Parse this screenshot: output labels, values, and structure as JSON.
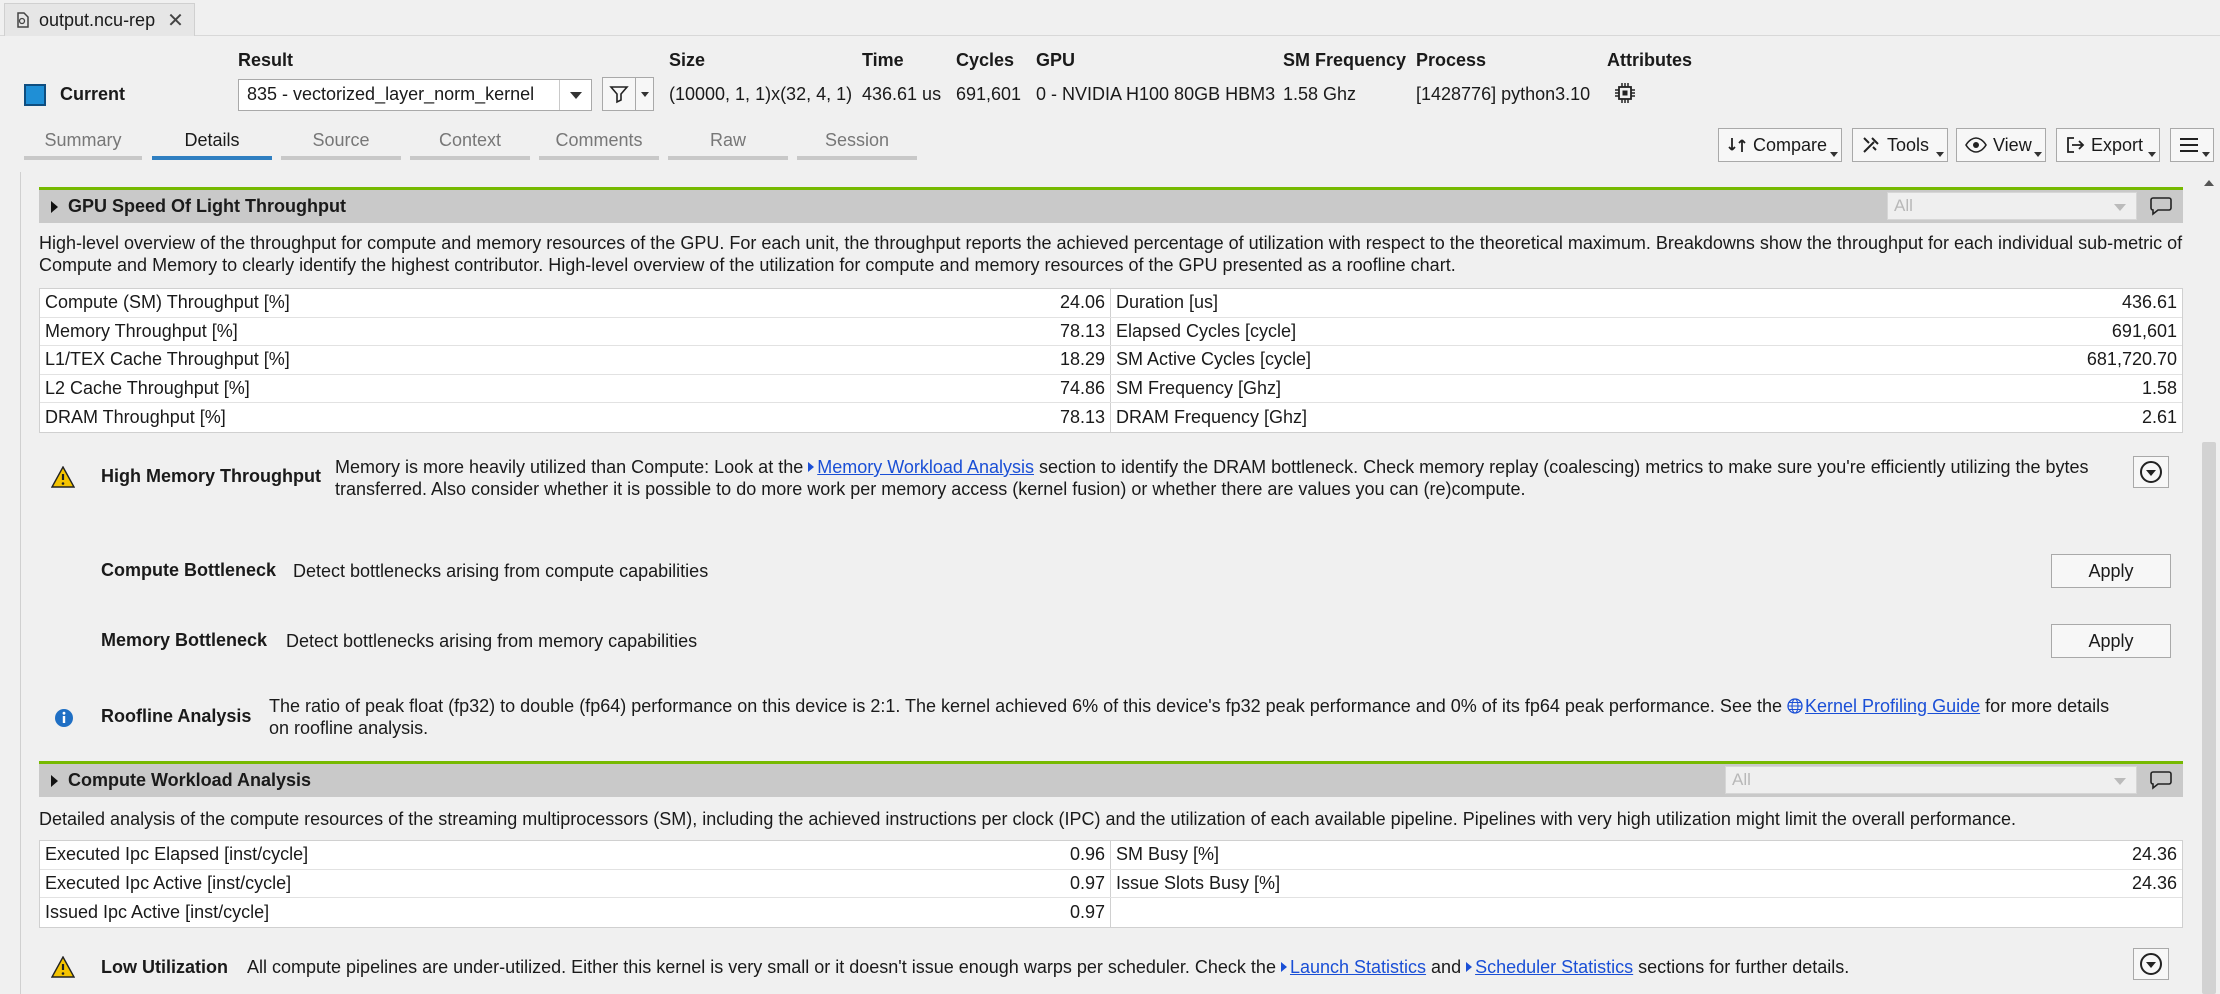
{
  "file_tab": {
    "name": "output.ncu-rep",
    "close": "✕"
  },
  "header": {
    "labels": {
      "result": "Result",
      "size": "Size",
      "time": "Time",
      "cycles": "Cycles",
      "gpu": "GPU",
      "sm_frequency": "SM Frequency",
      "process": "Process",
      "attributes": "Attributes"
    },
    "current_label": "Current",
    "current_color": "#1f8fd6",
    "result_value": "835 - vectorized_layer_norm_kernel",
    "size": "(10000, 1, 1)x(32, 4, 1)",
    "time": "436.61 us",
    "cycles": "691,601",
    "gpu": "0 - NVIDIA H100 80GB HBM3",
    "sm_frequency": "1.58 Ghz",
    "process": "[1428776] python3.10"
  },
  "page_tabs": [
    {
      "label": "Summary",
      "active": false
    },
    {
      "label": "Details",
      "active": true
    },
    {
      "label": "Source",
      "active": false
    },
    {
      "label": "Context",
      "active": false
    },
    {
      "label": "Comments",
      "active": false
    },
    {
      "label": "Raw",
      "active": false
    },
    {
      "label": "Session",
      "active": false
    }
  ],
  "toolbar": {
    "compare": "Compare",
    "tools": "Tools",
    "view": "View",
    "export": "Export"
  },
  "sections": {
    "sol": {
      "title": "GPU Speed Of Light Throughput",
      "filter": "All",
      "description": "High-level overview of the throughput for compute and memory resources of the GPU. For each unit, the throughput reports the achieved percentage of utilization with respect to the theoretical maximum. Breakdowns show the throughput for each individual sub-metric of Compute and Memory to clearly identify the highest contributor. High-level overview of the utilization for compute and memory resources of the GPU presented as a roofline chart.",
      "rows": [
        {
          "l_name": "Compute (SM) Throughput [%]",
          "l_val": "24.06",
          "r_name": "Duration [us]",
          "r_val": "436.61"
        },
        {
          "l_name": "Memory Throughput [%]",
          "l_val": "78.13",
          "r_name": "Elapsed Cycles [cycle]",
          "r_val": "691,601"
        },
        {
          "l_name": "L1/TEX Cache Throughput [%]",
          "l_val": "18.29",
          "r_name": "SM Active Cycles [cycle]",
          "r_val": "681,720.70"
        },
        {
          "l_name": "L2 Cache Throughput [%]",
          "l_val": "74.86",
          "r_name": "SM Frequency [Ghz]",
          "r_val": "1.58"
        },
        {
          "l_name": "DRAM Throughput [%]",
          "l_val": "78.13",
          "r_name": "DRAM Frequency [Ghz]",
          "r_val": "2.61"
        }
      ],
      "rule_high_mem": {
        "title": "High Memory Throughput",
        "text_before": "Memory is more heavily utilized than Compute: Look at the ",
        "link": "Memory Workload Analysis",
        "text_after": " section to identify the DRAM bottleneck. Check memory replay (coalescing) metrics to make sure you're efficiently utilizing the bytes transferred. Also consider whether it is possible to do more work per memory access (kernel fusion) or whether there are values you can (re)compute."
      },
      "rule_compute": {
        "title": "Compute Bottleneck",
        "text": "Detect bottlenecks arising from compute capabilities",
        "button": "Apply"
      },
      "rule_memory": {
        "title": "Memory Bottleneck",
        "text": "Detect bottlenecks arising from memory capabilities",
        "button": "Apply"
      },
      "rule_roofline": {
        "title": "Roofline Analysis",
        "text_before": "The ratio of peak float (fp32) to double (fp64) performance on this device is 2:1. The kernel achieved 6% of this device's fp32 peak performance and 0% of its fp64 peak performance. See the ",
        "link": "Kernel Profiling Guide",
        "text_after": " for more details on roofline analysis."
      }
    },
    "cwa": {
      "title": "Compute Workload Analysis",
      "filter": "All",
      "description": "Detailed analysis of the compute resources of the streaming multiprocessors (SM), including the achieved instructions per clock (IPC) and the utilization of each available pipeline. Pipelines with very high utilization might limit the overall performance.",
      "rows": [
        {
          "l_name": "Executed Ipc Elapsed [inst/cycle]",
          "l_val": "0.96",
          "r_name": "SM Busy [%]",
          "r_val": "24.36"
        },
        {
          "l_name": "Executed Ipc Active [inst/cycle]",
          "l_val": "0.97",
          "r_name": "Issue Slots Busy [%]",
          "r_val": "24.36"
        },
        {
          "l_name": "Issued Ipc Active [inst/cycle]",
          "l_val": "0.97",
          "r_name": "",
          "r_val": ""
        }
      ],
      "rule_low_util": {
        "title": "Low Utilization",
        "text_before": "All compute pipelines are under-utilized. Either this kernel is very small or it doesn't issue enough warps per scheduler. Check the ",
        "link1": "Launch Statistics",
        "text_mid": " and ",
        "link2": "Scheduler Statistics",
        "text_after": " sections for further details."
      }
    }
  }
}
